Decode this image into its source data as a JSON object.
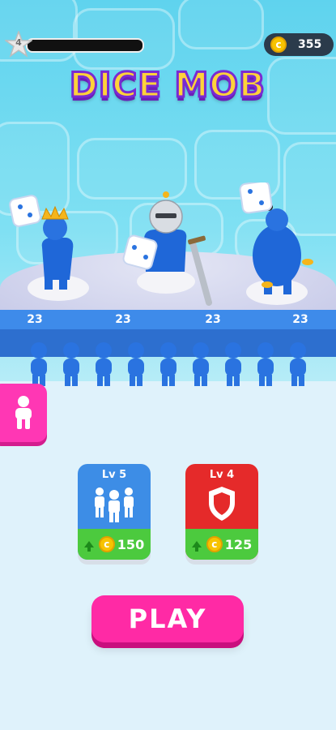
{
  "hud": {
    "level": "4",
    "coins": "355",
    "progress": 0
  },
  "title": "DICE MOB",
  "lanes": [
    "23",
    "23",
    "23",
    "23"
  ],
  "cards": [
    {
      "level": "Lv 5",
      "price": "150",
      "color": "#3d8de6",
      "icon": "crowd-icon"
    },
    {
      "level": "Lv 4",
      "price": "125",
      "color": "#e52a2a",
      "icon": "shield-icon"
    }
  ],
  "play_label": "PLAY",
  "colors": {
    "accent": "#ff2aa5",
    "upgrade_green": "#4cca3e",
    "mob_blue": "#1f67d8"
  }
}
